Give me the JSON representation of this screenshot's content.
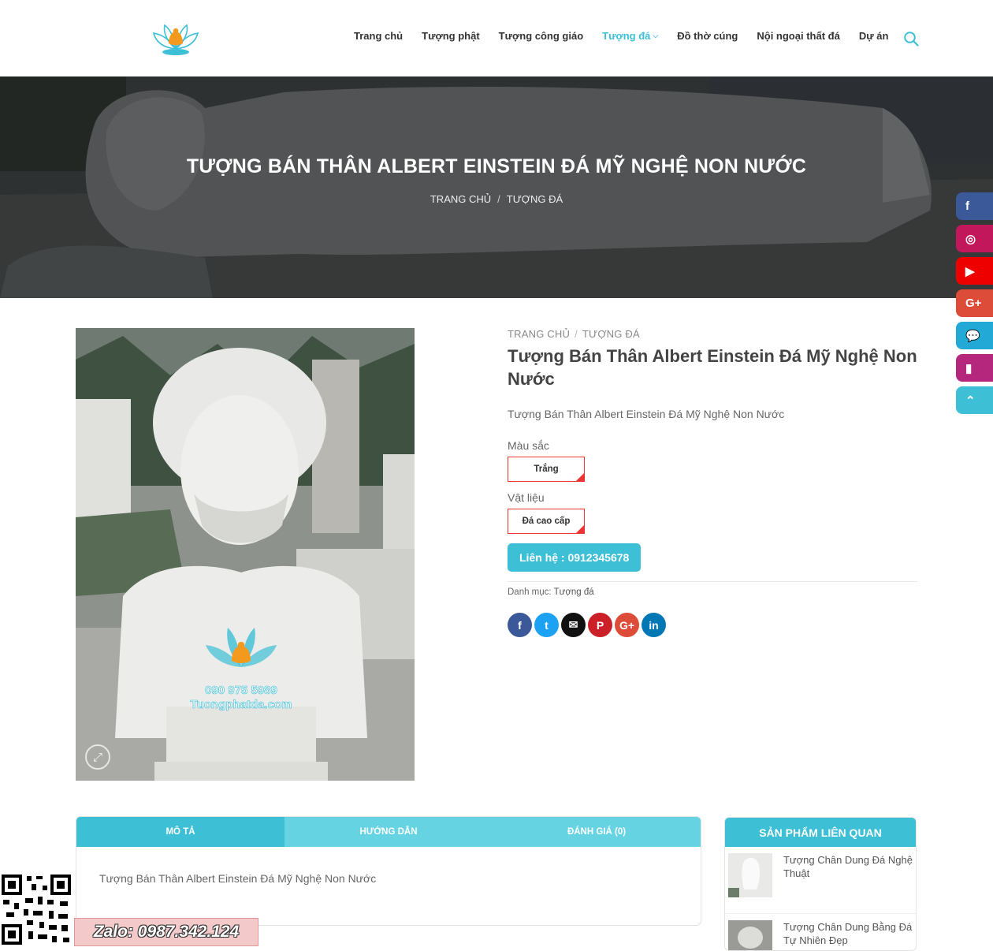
{
  "header": {
    "nav": [
      {
        "label": "Trang chủ",
        "active": false
      },
      {
        "label": "Tượng phật",
        "active": false
      },
      {
        "label": "Tượng công giáo",
        "active": false
      },
      {
        "label": "Tượng đá",
        "active": true
      },
      {
        "label": "Đồ thờ cúng",
        "active": false
      },
      {
        "label": "Nội ngoại thất đá",
        "active": false
      },
      {
        "label": "Dự án",
        "active": false
      }
    ],
    "nav_dropdown_glyph": "⌵"
  },
  "hero": {
    "title": "TƯỢNG BÁN THÂN ALBERT EINSTEIN ĐÁ MỸ NGHỆ NON NƯỚC",
    "crumb_home": "TRANG CHỦ",
    "crumb_sep": "/",
    "crumb_cat": "TƯỢNG ĐÁ"
  },
  "social_bar": [
    {
      "icon": "facebook-icon",
      "glyph": "f",
      "color": "#3b5998"
    },
    {
      "icon": "instagram-icon",
      "glyph": "◎",
      "color": "#c2185b"
    },
    {
      "icon": "youtube-icon",
      "glyph": "▶",
      "color": "#e00"
    },
    {
      "icon": "google-plus-icon",
      "glyph": "G+",
      "color": "#dd4b39"
    },
    {
      "icon": "chat-icon",
      "glyph": "💬",
      "color": "#22a9d6"
    },
    {
      "icon": "book-icon",
      "glyph": "▮",
      "color": "#b5267d"
    },
    {
      "icon": "back-to-top-icon",
      "glyph": "⌃",
      "color": "#3dbfd6"
    }
  ],
  "product": {
    "crumb_home": "TRANG CHỦ",
    "crumb_sep": "/",
    "crumb_cat": "TƯỢNG ĐÁ",
    "title": "Tượng Bán Thân Albert Einstein Đá Mỹ Nghệ Non Nước",
    "short_desc": "Tượng Bán Thân Albert Einstein Đá Mỹ Nghệ Non Nước",
    "color_label": "Màu sắc",
    "color_value": "Trắng",
    "material_label": "Vật liệu",
    "material_value": "Đá cao cấp",
    "contact_label": "Liên hệ : 0912345678",
    "category_prefix": "Danh mục:",
    "category_value": "Tượng đá",
    "watermark_phone": "090 975 5989",
    "watermark_site": "Tuongphatda.com",
    "share": [
      {
        "icon": "facebook-icon",
        "glyph": "f",
        "color": "#3b5998"
      },
      {
        "icon": "twitter-icon",
        "glyph": "t",
        "color": "#1da1f2"
      },
      {
        "icon": "email-icon",
        "glyph": "✉",
        "color": "#111"
      },
      {
        "icon": "pinterest-icon",
        "glyph": "P",
        "color": "#cb2027"
      },
      {
        "icon": "google-plus-icon",
        "glyph": "G+",
        "color": "#dd4b39"
      },
      {
        "icon": "linkedin-icon",
        "glyph": "in",
        "color": "#0077b5"
      }
    ]
  },
  "tabs": {
    "items": [
      {
        "label": "MÔ TẢ",
        "active": true
      },
      {
        "label": "HƯỚNG DẪN",
        "active": false
      },
      {
        "label": "ĐÁNH GIÁ (0)",
        "active": false
      }
    ],
    "content": "Tượng Bán Thân Albert Einstein Đá Mỹ Nghệ Non Nước"
  },
  "related": {
    "title": "SẢN PHẨM LIÊN QUAN",
    "items": [
      {
        "name": "Tượng Chân Dung Đá Nghệ Thuật"
      },
      {
        "name": "Tượng Chân Dung Bằng Đá Tự Nhiên Đẹp"
      }
    ]
  },
  "zalo": {
    "label": "Zalo: 0987.342.124"
  }
}
